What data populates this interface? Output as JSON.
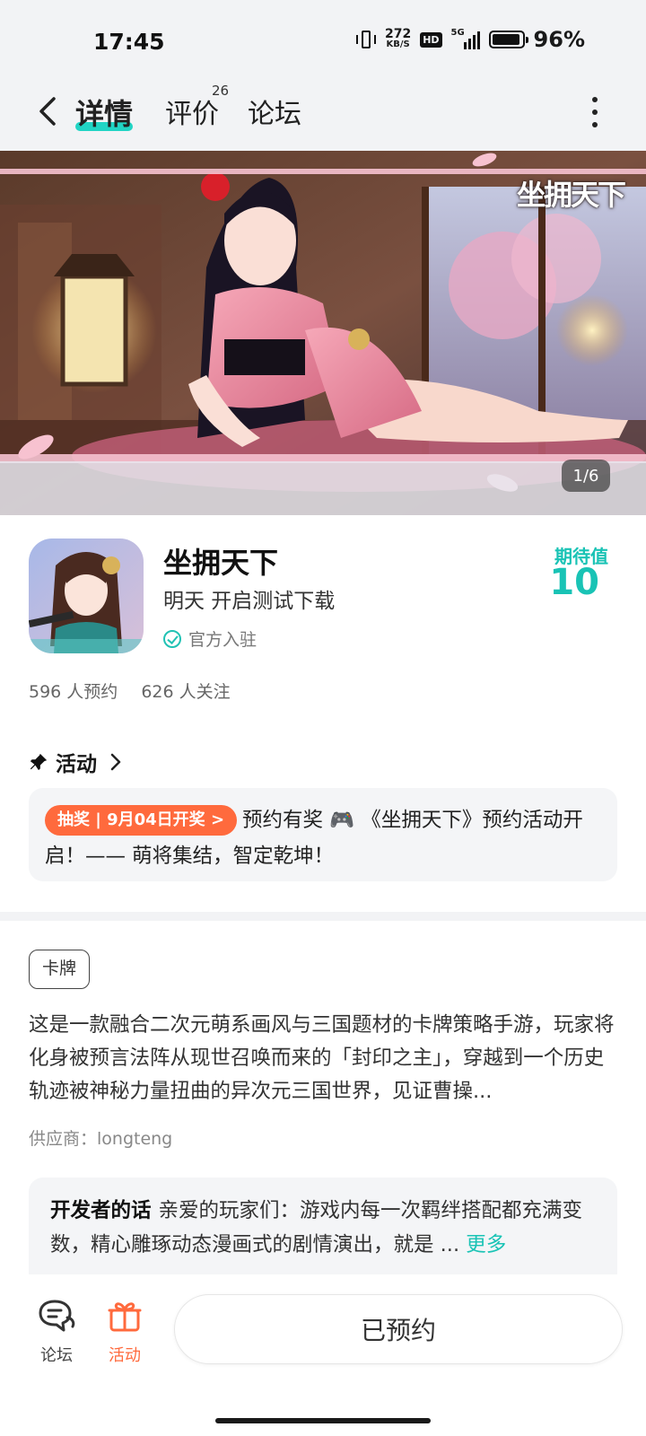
{
  "status_bar": {
    "time": "17:45",
    "net_speed_value": "272",
    "net_speed_unit": "KB/S",
    "hd": "HD",
    "network": "5G",
    "battery": "96%",
    "battery_level": 0.96
  },
  "nav": {
    "tabs": [
      {
        "label": "详情",
        "active": true
      },
      {
        "label": "评价",
        "count": "26"
      },
      {
        "label": "论坛"
      }
    ]
  },
  "banner": {
    "logo_text": "坐拥天下",
    "page_counter": "1/6"
  },
  "game": {
    "title": "坐拥天下",
    "subtitle": "明天 开启测试下载",
    "official_label": "官方入驻",
    "expect_label": "期待值",
    "expect_value": "10",
    "reservations": "596 人预约",
    "followers": "626 人关注"
  },
  "activity": {
    "header": "活动",
    "badge": "抽奖 | 9月04日开奖 >",
    "text": "预约有奖 🎮 《坐拥天下》预约活动开启！—— 萌将集结，智定乾坤！"
  },
  "description": {
    "tag": "卡牌",
    "text": "这是一款融合二次元萌系画风与三国题材的卡牌策略手游，玩家将化身被预言法阵从现世召唤而来的「封印之主」，穿越到一个历史轨迹被神秘力量扭曲的异次元三国世界，见证曹操...",
    "supplier": "供应商：longteng"
  },
  "developer": {
    "label": "开发者的话",
    "text": "亲爱的玩家们：游戏内每一次羁绊搭配都充满变数，精心雕琢动态漫画式的剧情演出，就是 ...",
    "more": "更多"
  },
  "bottom": {
    "forum_label": "论坛",
    "activity_label": "活动",
    "reserved_label": "已预约",
    "colors": {
      "accent": "#19c3b5",
      "activity": "#ff6a3d"
    }
  }
}
